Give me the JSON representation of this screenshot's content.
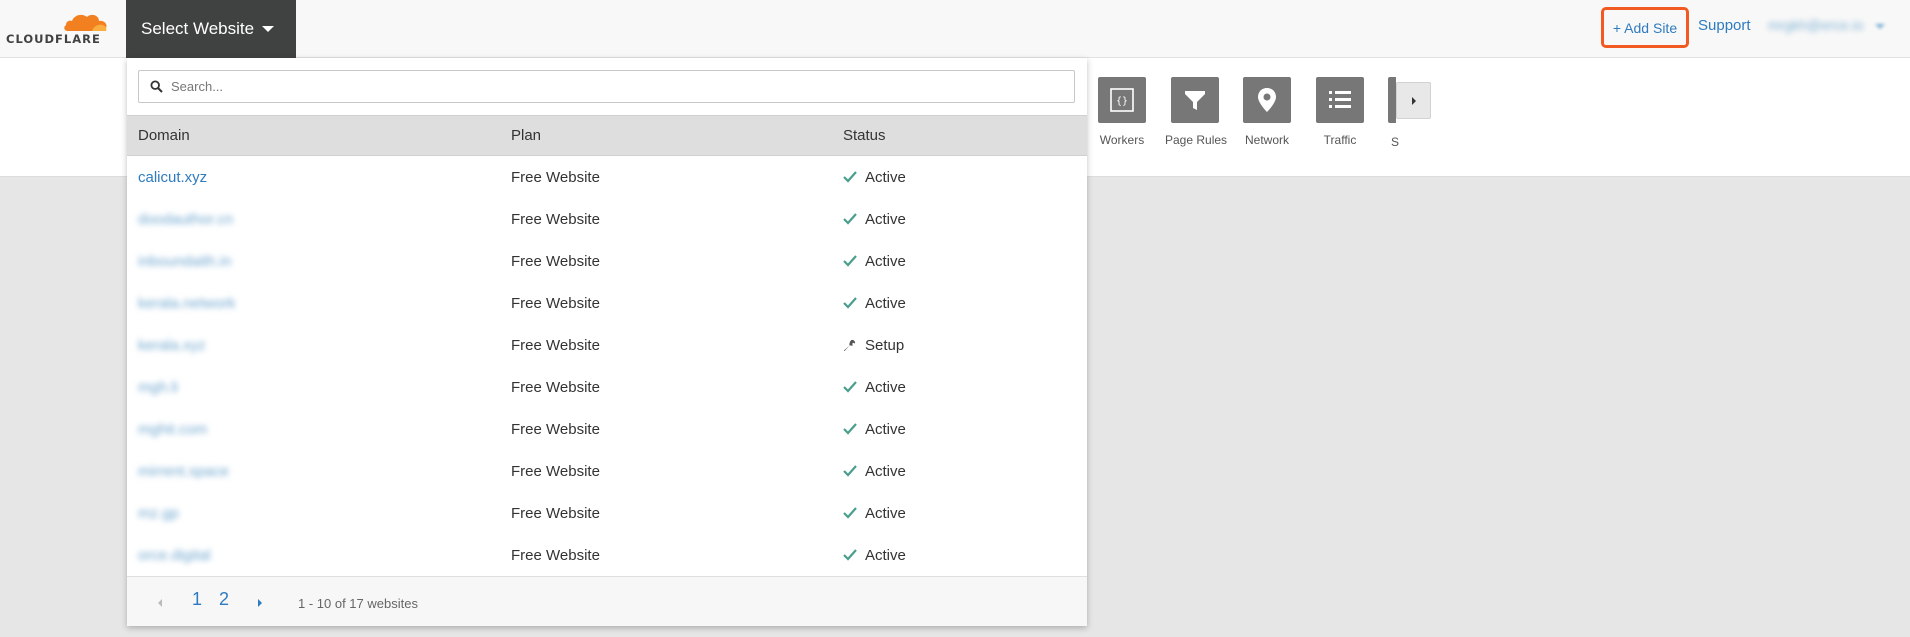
{
  "header": {
    "logo_text": "CLOUDFLARE",
    "select_website_label": "Select Website",
    "add_site_label": "+ Add Site",
    "support_label": "Support",
    "user_email": "mrgkh@erce.io"
  },
  "apps": [
    {
      "label": "Workers",
      "icon": "workers-icon"
    },
    {
      "label": "Page Rules",
      "icon": "filter-icon"
    },
    {
      "label": "Network",
      "icon": "map-pin-icon"
    },
    {
      "label": "Traffic",
      "icon": "list-icon"
    }
  ],
  "app_partial_label": "S",
  "website_dropdown": {
    "search_placeholder": "Search...",
    "columns": {
      "domain": "Domain",
      "plan": "Plan",
      "status": "Status"
    },
    "rows": [
      {
        "domain": "calicut.xyz",
        "plan": "Free Website",
        "status": "Active",
        "status_icon": "check-icon"
      },
      {
        "domain": "doodauthor.cn",
        "plan": "Free Website",
        "status": "Active",
        "status_icon": "check-icon"
      },
      {
        "domain": "inboundaith.in",
        "plan": "Free Website",
        "status": "Active",
        "status_icon": "check-icon"
      },
      {
        "domain": "kerala.network",
        "plan": "Free Website",
        "status": "Active",
        "status_icon": "check-icon"
      },
      {
        "domain": "kerala.xyz",
        "plan": "Free Website",
        "status": "Setup",
        "status_icon": "wrench-icon"
      },
      {
        "domain": "mgh.li",
        "plan": "Free Website",
        "status": "Active",
        "status_icon": "check-icon"
      },
      {
        "domain": "mghit.com",
        "plan": "Free Website",
        "status": "Active",
        "status_icon": "check-icon"
      },
      {
        "domain": "mirrent.space",
        "plan": "Free Website",
        "status": "Active",
        "status_icon": "check-icon"
      },
      {
        "domain": "mz.gp",
        "plan": "Free Website",
        "status": "Active",
        "status_icon": "check-icon"
      },
      {
        "domain": "orce.digital",
        "plan": "Free Website",
        "status": "Active",
        "status_icon": "check-icon"
      }
    ],
    "pagination": {
      "pages": [
        "1",
        "2"
      ],
      "current_page": "1",
      "summary": "1 - 10 of 17 websites"
    }
  },
  "colors": {
    "accent_orange": "#f15a22",
    "link_blue": "#2f7bbf",
    "header_dark": "#404242",
    "check_green": "#4a9e8e"
  }
}
